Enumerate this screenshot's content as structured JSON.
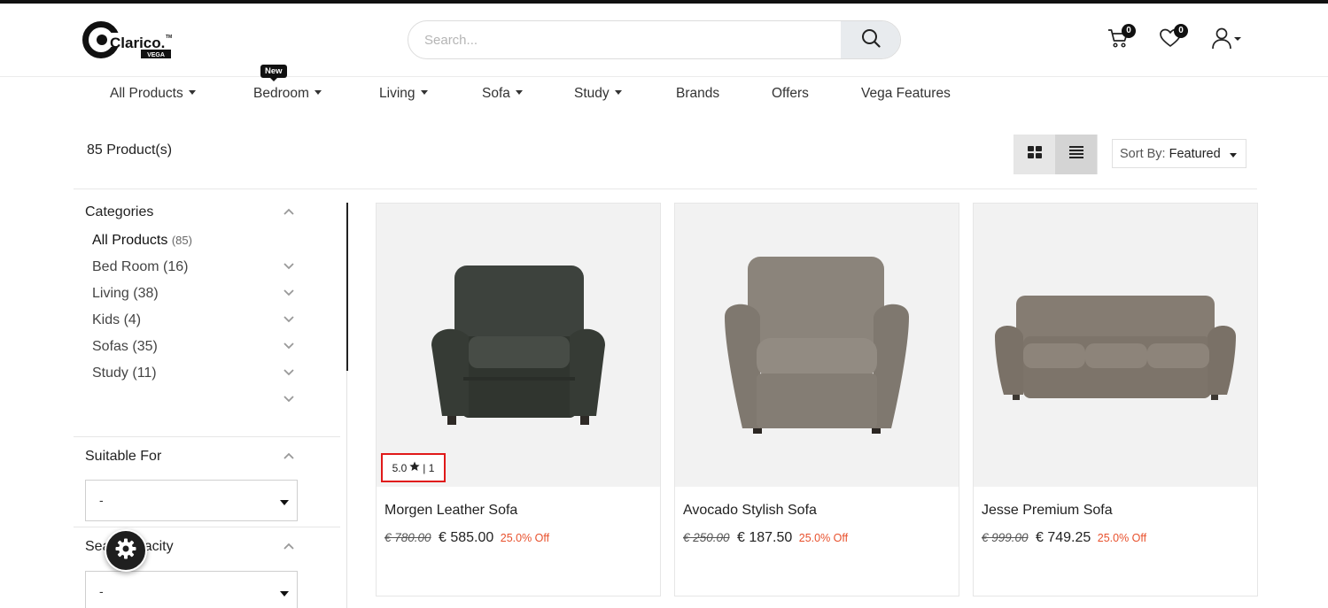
{
  "brand": {
    "name": "Clarico.",
    "tm": "TM",
    "sub": "VEGA"
  },
  "search": {
    "placeholder": "Search..."
  },
  "header": {
    "cart_count": "0",
    "wishlist_count": "0"
  },
  "nav": {
    "new_tag": "New",
    "items": [
      {
        "label": "All Products",
        "dropdown": true
      },
      {
        "label": "Bedroom",
        "dropdown": true
      },
      {
        "label": "Living",
        "dropdown": true
      },
      {
        "label": "Sofa",
        "dropdown": true
      },
      {
        "label": "Study",
        "dropdown": true
      },
      {
        "label": "Brands",
        "dropdown": false
      },
      {
        "label": "Offers",
        "dropdown": false
      },
      {
        "label": "Vega Features",
        "dropdown": false
      }
    ]
  },
  "toolbar": {
    "product_count": "85 Product(s)",
    "sort_label": "Sort By:",
    "sort_value": "Featured"
  },
  "sidebar": {
    "categories_title": "Categories",
    "categories": [
      {
        "label": "All Products",
        "count": "(85)"
      },
      {
        "label": "Bed Room (16)"
      },
      {
        "label": "Living (38)"
      },
      {
        "label": "Kids (4)"
      },
      {
        "label": "Sofas (35)"
      },
      {
        "label": "Study (11)"
      }
    ],
    "suitable_title": "Suitable For",
    "suitable_value": "-",
    "seat_title": "Seat Capacity",
    "seat_value": "-"
  },
  "products": [
    {
      "name": "Morgen Leather Sofa",
      "old_price": "€ 780.00",
      "price": "€ 585.00",
      "off": "25.0% Off",
      "rating": "5.0",
      "reviews": "| 1"
    },
    {
      "name": "Avocado Stylish Sofa",
      "old_price": "€ 250.00",
      "price": "€ 187.50",
      "off": "25.0% Off"
    },
    {
      "name": "Jesse Premium Sofa",
      "old_price": "€ 999.00",
      "price": "€ 749.25",
      "off": "25.0% Off"
    }
  ],
  "colors": {
    "discount": "#e8512d",
    "rating_border": "#e01919",
    "dark": "#111111"
  },
  "icons": [
    "search-icon",
    "cart-icon",
    "heart-icon",
    "user-icon",
    "grid-view-icon",
    "list-view-icon",
    "gear-icon",
    "star-icon"
  ]
}
